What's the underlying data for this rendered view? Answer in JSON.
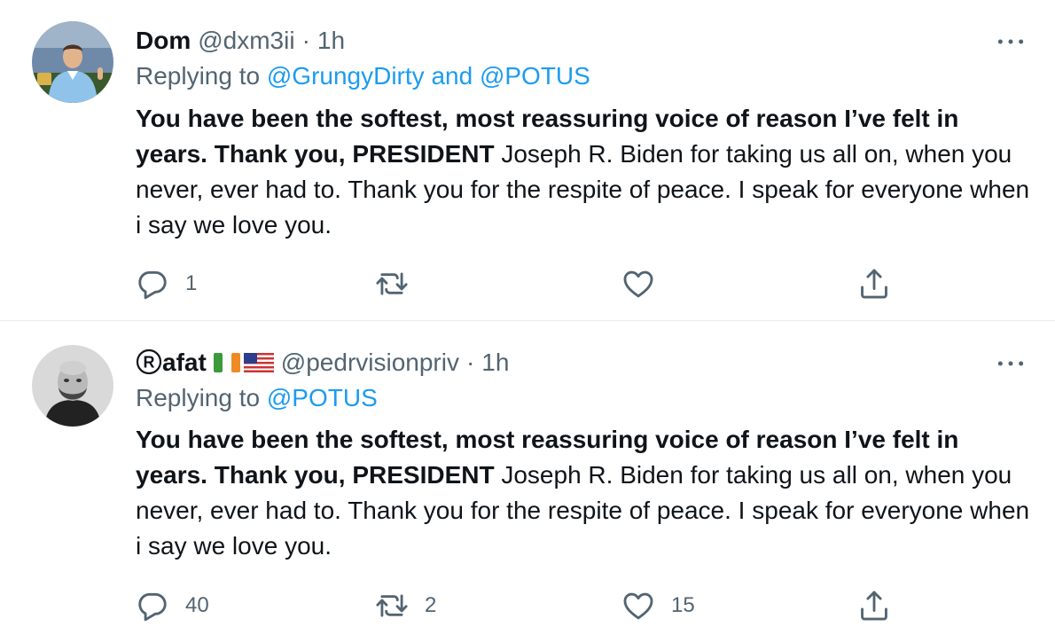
{
  "tweets": [
    {
      "name": "Dom",
      "handle": "@dxm3ii",
      "separator": "·",
      "time": "1h",
      "replying_prefix": "Replying to",
      "replying_mentions": "@GrungyDirty and @POTUS",
      "body_bold": "You have been the softest, most reassuring voice of reason I’ve felt in years. Thank you, PRESIDENT",
      "body_regular": " Joseph R. Biden for taking us all on, when you never, ever had to. Thank you for the respite of peace. I speak for everyone when i say we love you.",
      "counts": {
        "replies": "1",
        "retweets": "",
        "likes": ""
      },
      "icons": [
        "more-icon",
        "reply-icon",
        "retweet-icon",
        "like-icon",
        "share-icon"
      ]
    },
    {
      "name_mark": "R",
      "name": "afat",
      "flags": [
        "ireland-flag",
        "usa-flag"
      ],
      "handle": "@pedrvisionpriv",
      "separator": "·",
      "time": "1h",
      "replying_prefix": "Replying to",
      "replying_mentions": "@POTUS",
      "body_bold": "You have been the softest, most reassuring voice of reason I’ve felt in years. Thank you, PRESIDENT",
      "body_regular": " Joseph R. Biden for taking us all on, when you never, ever had to. Thank you for the respite of peace. I speak for everyone when i say we love you.",
      "counts": {
        "replies": "40",
        "retweets": "2",
        "likes": "15"
      },
      "icons": [
        "more-icon",
        "reply-icon",
        "retweet-icon",
        "like-icon",
        "share-icon"
      ]
    }
  ],
  "colors": {
    "text": "#0f1419",
    "secondary": "#536471",
    "link": "#1d9bf0",
    "divider": "#e6ecf0"
  }
}
